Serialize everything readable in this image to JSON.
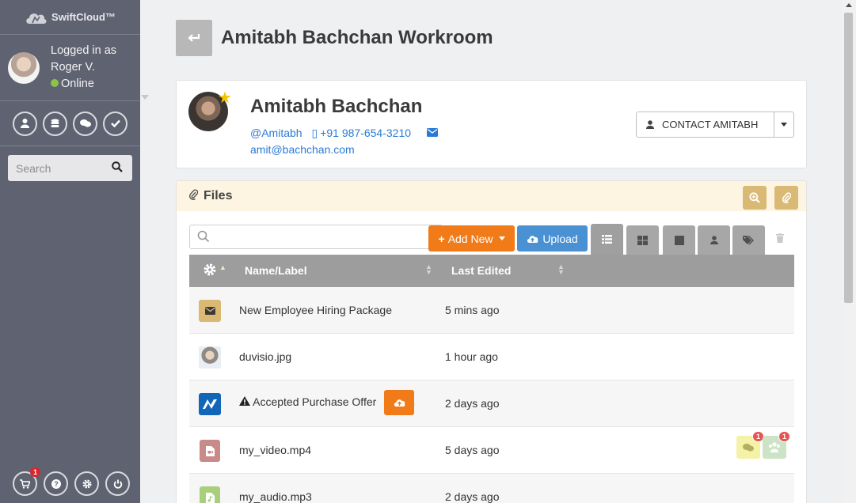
{
  "sidebar": {
    "brand": "SwiftCloud™",
    "user": {
      "line1": "Logged in as",
      "line2": "Roger V.",
      "status": "Online"
    },
    "search_placeholder": "Search",
    "cart_count": "1"
  },
  "page": {
    "title": "Amitabh Bachchan Workroom"
  },
  "contact": {
    "name": "Amitabh Bachchan",
    "handle": "@Amitabh",
    "phone": "+91 987-654-3210",
    "email": "amit@bachchan.com",
    "button_label": "CONTACT AMITABH"
  },
  "files": {
    "title": "Files",
    "add_new_label": "Add New",
    "upload_label": "Upload",
    "columns": {
      "name": "Name/Label",
      "last_edited": "Last Edited"
    },
    "rows": [
      {
        "name": "New Employee Hiring Package",
        "edited": "5 mins ago",
        "icon": "envelope-icon"
      },
      {
        "name": "duvisio.jpg",
        "edited": "1 hour ago",
        "icon": "image-thumbnail"
      },
      {
        "name": "Accepted Purchase Offer",
        "edited": "2 days ago",
        "icon": "document-logo"
      },
      {
        "name": "my_video.mp4",
        "edited": "5 days ago",
        "icon": "video-file-icon",
        "comments": "1",
        "shares": "1"
      },
      {
        "name": "my_audio.mp3",
        "edited": "2 days ago",
        "icon": "audio-file-icon"
      }
    ]
  },
  "colors": {
    "sidebar_bg": "#5f6270",
    "accent_orange": "#f27b19",
    "accent_blue": "#4a91d4",
    "files_header_bg": "#fdf5e2",
    "gold": "#dab975"
  }
}
